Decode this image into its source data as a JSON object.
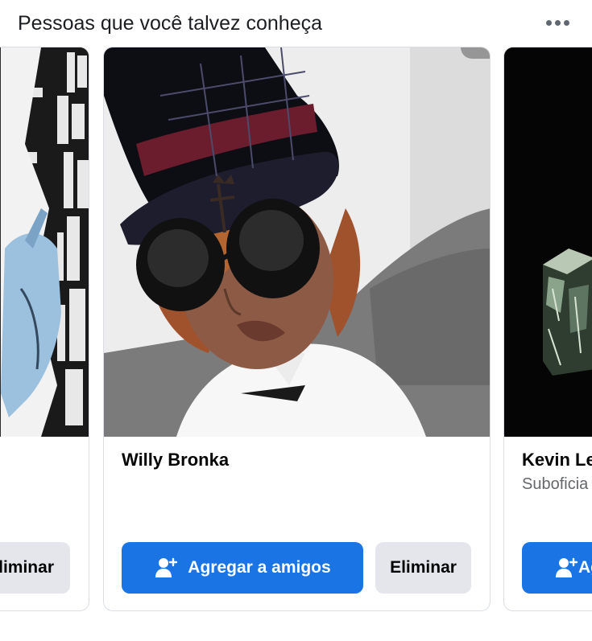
{
  "header": {
    "title": "Pessoas que você talvez conheça",
    "more_icon": "more-horizontal-icon"
  },
  "cards": [
    {
      "name": "",
      "remove_label": "Eliminar",
      "photo": "comic-style illustration with blue hand"
    },
    {
      "name": "Willy Bronka",
      "add_label": "Agregar a amigos",
      "remove_label": "Eliminar",
      "photo": "person with top hat and large sunglasses"
    },
    {
      "name": "Kevin Le",
      "subtitle": "Suboficia",
      "add_label": "Agregar a amigos",
      "photo": "dark image with green box"
    }
  ],
  "colors": {
    "primary_button": "#1b74e4",
    "secondary_button": "#e4e6eb",
    "card_border": "#dadde1",
    "subtitle_text": "#65676b"
  }
}
